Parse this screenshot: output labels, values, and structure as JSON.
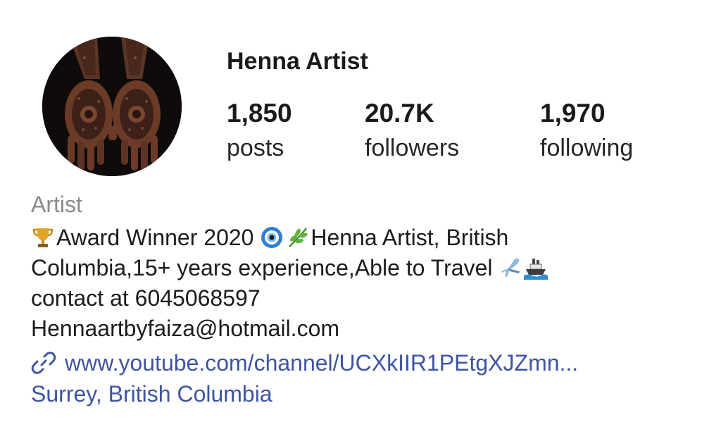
{
  "profile": {
    "name": "Henna Artist",
    "category": "Artist",
    "stats": {
      "posts": {
        "value": "1,850",
        "label": "posts"
      },
      "followers": {
        "value": "20.7K",
        "label": "followers"
      },
      "following": {
        "value": "1,970",
        "label": "following"
      }
    },
    "bio": {
      "line1_text1": "Award Winner 2020 ",
      "line1_text2": "Henna Artist, British",
      "line2_text": "Columbia,15+ years experience,Able to Travel ",
      "line3": "contact at 6045068597",
      "line4": "Hennaartbyfaiza@hotmail.com"
    },
    "link": "www.youtube.com/channel/UCXkIIR1PEtgXJZmn...",
    "location": "Surrey, British Columbia"
  },
  "icons": {
    "avatar": "henna-hands-photo",
    "trophy": "trophy-icon",
    "nazar": "nazar-eye-icon",
    "herb": "herb-icon",
    "airplane": "airplane-icon",
    "ship": "ship-icon",
    "link": "link-icon"
  },
  "colors": {
    "link": "#3e54a3",
    "category": "#8a8a8a",
    "text": "#1c1c1c"
  }
}
